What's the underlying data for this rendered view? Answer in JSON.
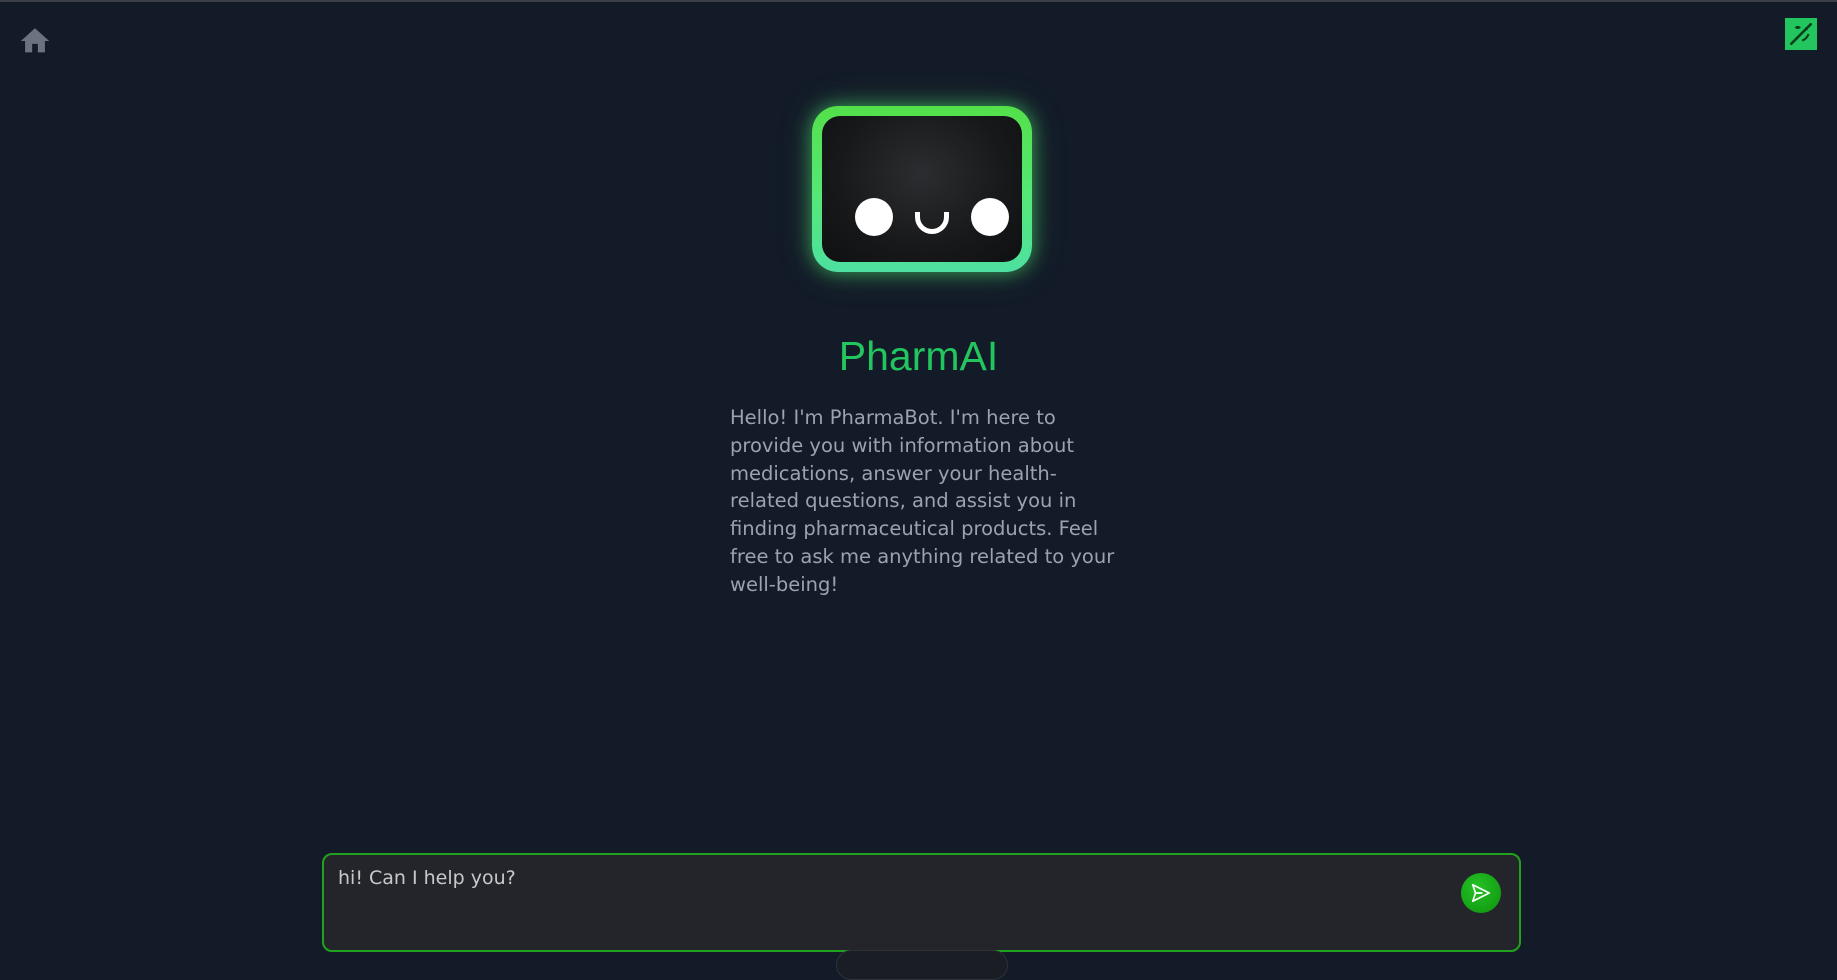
{
  "app": {
    "title": "PharmAI"
  },
  "nav": {
    "home_icon": "home-icon",
    "theme_icon": "theme-toggle-icon"
  },
  "bot": {
    "avatar_icon": "robot-face-icon",
    "intro": "Hello! I'm PharmaBot. I'm here to provide you with information about medications, answer your health-related questions, and assist you in finding pharmaceutical products. Feel free to ask me anything related to your well-being!"
  },
  "chat": {
    "placeholder": "hi! Can I help you?",
    "send_icon": "send-icon"
  },
  "colors": {
    "background": "#131a28",
    "accent": "#22c55e",
    "input_border": "#1fa31f",
    "send_button": "#14a014",
    "text_muted": "#9ca3af"
  }
}
